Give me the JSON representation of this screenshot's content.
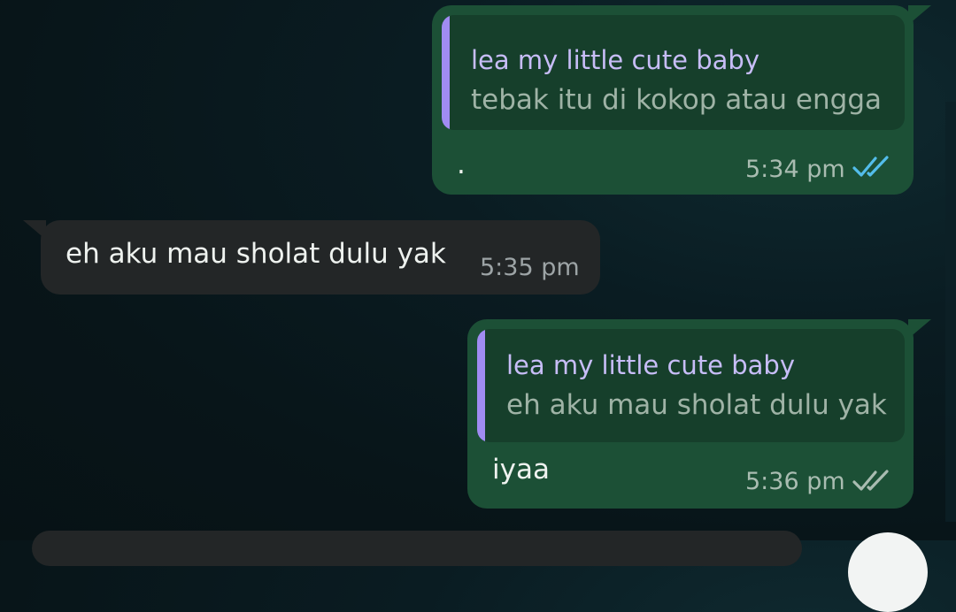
{
  "messages": [
    {
      "direction": "outgoing",
      "reply_to": {
        "author": "lea my little cute baby",
        "text": "tebak itu di kokop atau engga"
      },
      "text": ".",
      "time": "5:34 pm",
      "status": "read",
      "status_icon": "double-check-icon",
      "status_color": "#53bdeb"
    },
    {
      "direction": "incoming",
      "text": "eh aku mau sholat dulu yak",
      "time": "5:35 pm"
    },
    {
      "direction": "outgoing",
      "reply_to": {
        "author": "lea my little cute baby",
        "text": "eh aku mau sholat dulu yak"
      },
      "text": "iyaa",
      "time": "5:36 pm",
      "status": "delivered",
      "status_icon": "double-check-icon",
      "status_color": "#a9bcb1"
    }
  ],
  "colors": {
    "outgoing_bubble": "#1c5036",
    "incoming_bubble": "#232627",
    "quote_bar": "#a08cf2",
    "quote_author": "#c7bdf7",
    "background": "#0a1c22"
  }
}
